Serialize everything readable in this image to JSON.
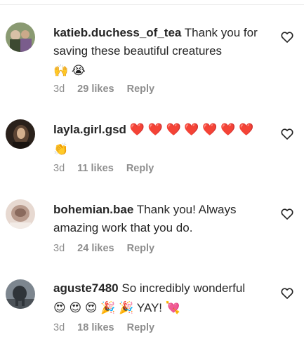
{
  "comments": [
    {
      "username": "katieb.duchess_of_tea",
      "text": "Thank you for saving these beautiful creatures",
      "emoji_line": "🙌 😭",
      "time": "3d",
      "likes": "29 likes",
      "reply": "Reply",
      "avatar_colors": [
        "#6b7a58",
        "#c9b49a",
        "#3d4a32"
      ]
    },
    {
      "username": "layla.girl.gsd",
      "text": "❤️ ❤️ ❤️ ❤️ ❤️ ❤️ ❤️",
      "emoji_line": "👏",
      "time": "3d",
      "likes": "11 likes",
      "reply": "Reply",
      "avatar_colors": [
        "#3a2c22",
        "#c9a886",
        "#1f1711"
      ]
    },
    {
      "username": "bohemian.bae",
      "text": "Thank you! Always amazing work that you do.",
      "emoji_line": "",
      "time": "3d",
      "likes": "24 likes",
      "reply": "Reply",
      "avatar_colors": [
        "#d9c7bd",
        "#b49484",
        "#efe5df"
      ]
    },
    {
      "username": "aguste7480",
      "text": "So incredibly wonderful",
      "emoji_line": "😍 😍 😍 🎉 🎉 YAY! 💘",
      "time": "3d",
      "likes": "18 likes",
      "reply": "Reply",
      "avatar_colors": [
        "#5e6670",
        "#2e3338",
        "#8c949c"
      ]
    }
  ],
  "heart_color": "#262626"
}
